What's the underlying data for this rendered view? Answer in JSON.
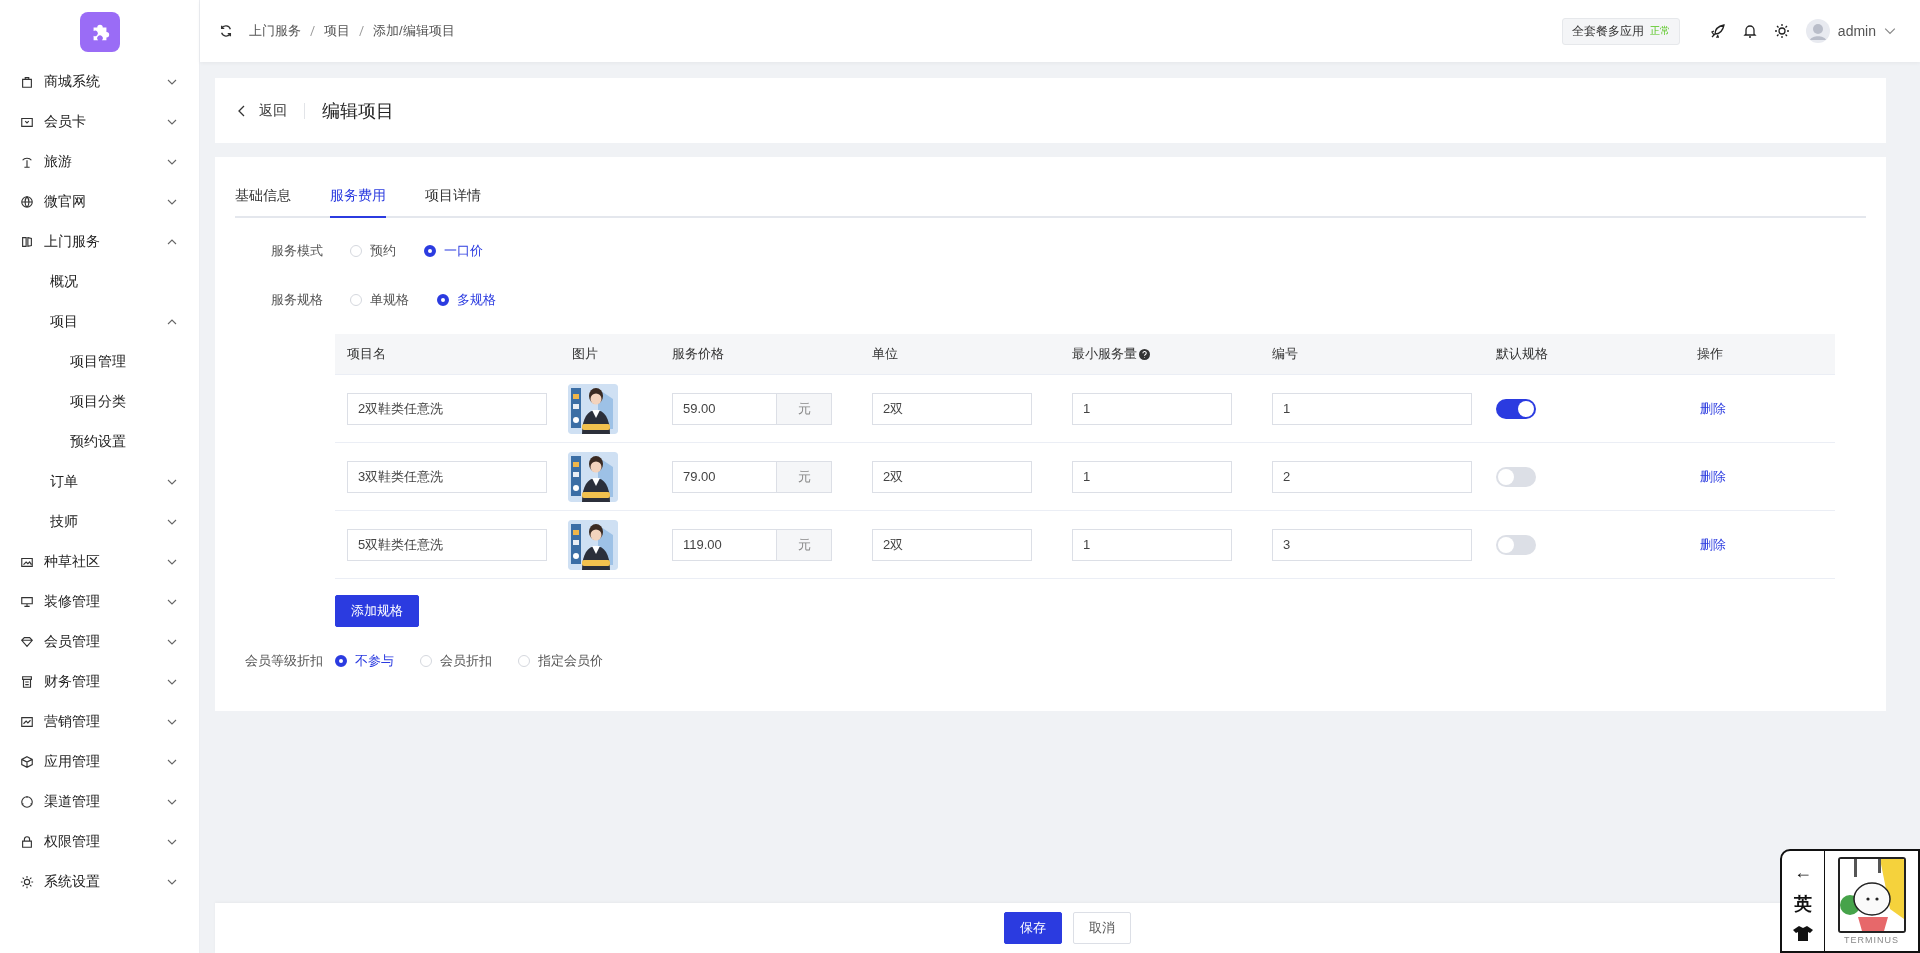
{
  "sidebar": {
    "items": [
      {
        "label": "商城系统",
        "kind": "group",
        "expanded": false
      },
      {
        "label": "会员卡",
        "kind": "group",
        "expanded": false
      },
      {
        "label": "旅游",
        "kind": "group",
        "expanded": false
      },
      {
        "label": "微官网",
        "kind": "group",
        "expanded": false
      },
      {
        "label": "上门服务",
        "kind": "group",
        "expanded": true,
        "children": [
          {
            "label": "概况",
            "kind": "link"
          },
          {
            "label": "项目",
            "kind": "group",
            "expanded": true,
            "children": [
              {
                "label": "项目管理"
              },
              {
                "label": "项目分类"
              },
              {
                "label": "预约设置"
              }
            ]
          },
          {
            "label": "订单",
            "kind": "group",
            "expanded": false
          },
          {
            "label": "技师",
            "kind": "group",
            "expanded": false
          }
        ]
      },
      {
        "label": "种草社区",
        "kind": "group",
        "expanded": false
      },
      {
        "label": "装修管理",
        "kind": "group",
        "expanded": false
      },
      {
        "label": "会员管理",
        "kind": "group",
        "expanded": false
      },
      {
        "label": "财务管理",
        "kind": "group",
        "expanded": false
      },
      {
        "label": "营销管理",
        "kind": "group",
        "expanded": false
      },
      {
        "label": "应用管理",
        "kind": "group",
        "expanded": false
      },
      {
        "label": "渠道管理",
        "kind": "group",
        "expanded": false
      },
      {
        "label": "权限管理",
        "kind": "group",
        "expanded": false
      },
      {
        "label": "系统设置",
        "kind": "group",
        "expanded": false
      }
    ]
  },
  "topbar": {
    "breadcrumb": [
      "上门服务",
      "项目",
      "添加/编辑项目"
    ],
    "plan": {
      "label": "全套餐多应用",
      "status": "正常"
    },
    "user": "admin"
  },
  "page_header": {
    "back": "返回",
    "title": "编辑项目"
  },
  "tabs": [
    {
      "label": "基础信息",
      "selected": false
    },
    {
      "label": "服务费用",
      "selected": true
    },
    {
      "label": "项目详情",
      "selected": false
    }
  ],
  "service_mode": {
    "label": "服务模式",
    "options": [
      {
        "label": "预约",
        "selected": false
      },
      {
        "label": "一口价",
        "selected": true
      }
    ]
  },
  "service_spec": {
    "label": "服务规格",
    "options": [
      {
        "label": "单规格",
        "selected": false
      },
      {
        "label": "多规格",
        "selected": true
      }
    ]
  },
  "table": {
    "columns": [
      {
        "label": "项目名"
      },
      {
        "label": "图片"
      },
      {
        "label": "服务价格"
      },
      {
        "label": "单位"
      },
      {
        "label": "最小服务量",
        "help": true
      },
      {
        "label": "编号"
      },
      {
        "label": "默认规格"
      },
      {
        "label": "操作"
      }
    ],
    "rows": [
      {
        "name": "2双鞋类任意洗",
        "price": "59.00",
        "currency": "元",
        "unit": "2双",
        "min_qty": "1",
        "code": "1",
        "default": true,
        "action": "删除"
      },
      {
        "name": "3双鞋类任意洗",
        "price": "79.00",
        "currency": "元",
        "unit": "2双",
        "min_qty": "1",
        "code": "2",
        "default": false,
        "action": "删除"
      },
      {
        "name": "5双鞋类任意洗",
        "price": "119.00",
        "currency": "元",
        "unit": "2双",
        "min_qty": "1",
        "code": "3",
        "default": false,
        "action": "删除"
      }
    ]
  },
  "add_spec_button": "添加规格",
  "member_discount": {
    "label": "会员等级折扣",
    "options": [
      {
        "label": "不参与",
        "selected": true
      },
      {
        "label": "会员折扣",
        "selected": false
      },
      {
        "label": "指定会员价",
        "selected": false
      }
    ]
  },
  "footer": {
    "save": "保存",
    "cancel": "取消"
  },
  "widget": {
    "arrow": "←",
    "language": "英",
    "caption": "TERMINUS"
  }
}
